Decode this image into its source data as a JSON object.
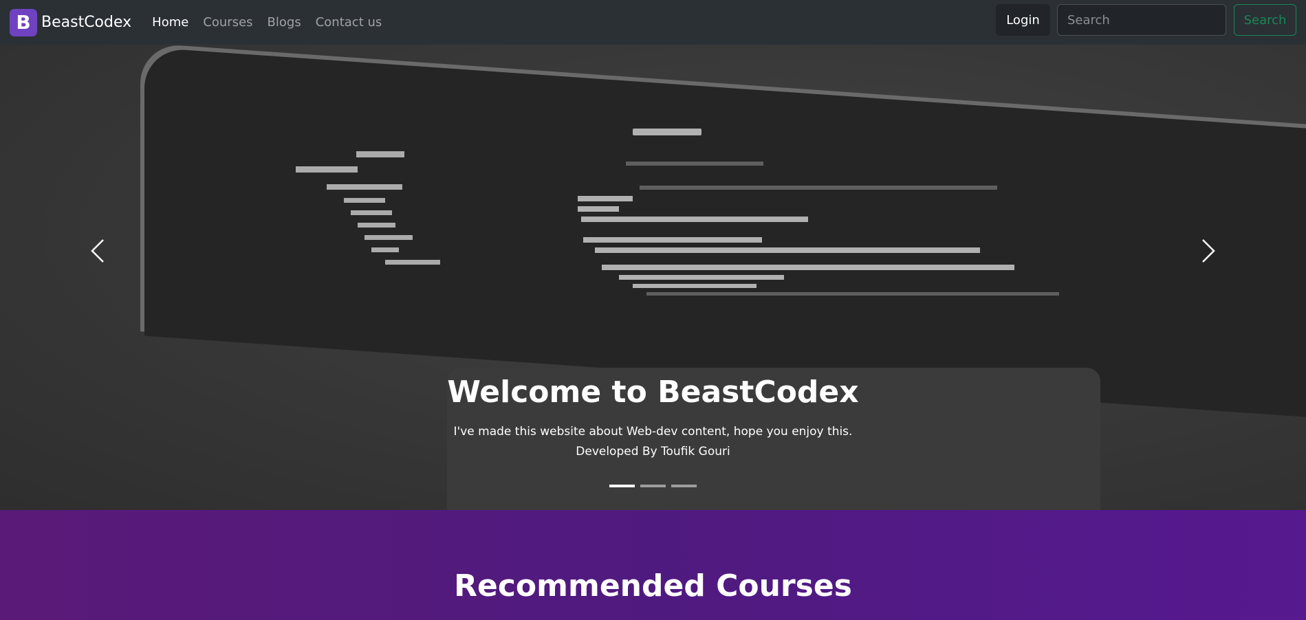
{
  "navbar": {
    "brand_letter": "B",
    "brand_name": "BeastCodex",
    "links": [
      "Home",
      "Courses",
      "Blogs",
      "Contact us"
    ],
    "active_link": "Home",
    "login_label": "Login",
    "search_placeholder": "Search",
    "search_button_label": "Search"
  },
  "carousel": {
    "title": "Welcome to BeastCodex",
    "line1": "I've made this website about Web-dev content, hope you enjoy this.",
    "line2": "Developed By Toufik Gouri",
    "indicator_count": 3,
    "active_index": 0,
    "prev_icon": "chevron-left-icon",
    "next_icon": "chevron-right-icon"
  },
  "courses_section": {
    "title": "Recommended Courses"
  },
  "colors": {
    "brand_accent": "#6f42c1",
    "success": "#198754",
    "courses_bg": "#52197f"
  }
}
